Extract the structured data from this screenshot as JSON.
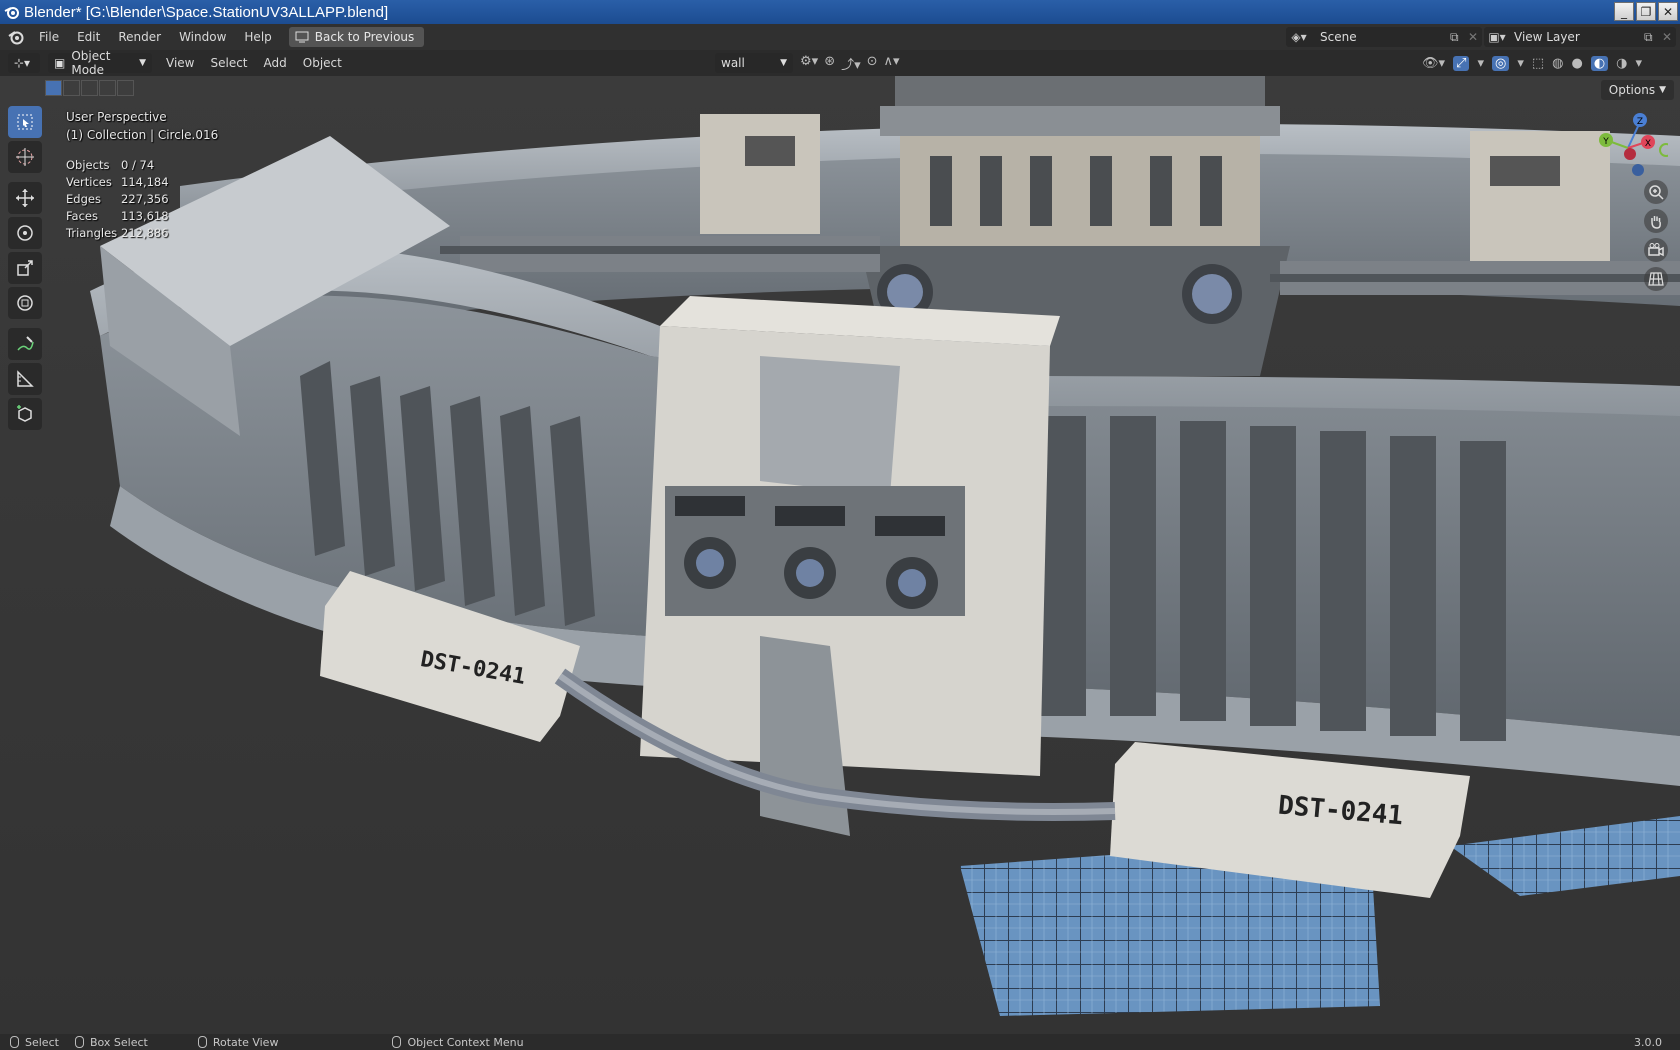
{
  "window": {
    "title": "Blender* [G:\\Blender\\Space.StationUV3ALLAPP.blend]",
    "controls": [
      "minimize-icon",
      "restore-icon",
      "close-icon"
    ]
  },
  "topbar": {
    "menus": [
      "File",
      "Edit",
      "Render",
      "Window",
      "Help"
    ],
    "back_to_previous": "Back to Previous",
    "scene_name": "Scene",
    "view_layer": "View Layer"
  },
  "viewport_header": {
    "mode": "Object Mode",
    "menus": [
      "View",
      "Select",
      "Add",
      "Object"
    ],
    "material_dropdown": "wall",
    "options_label": "Options"
  },
  "overlay": {
    "perspective": "User Perspective",
    "collection": "(1) Collection | Circle.016",
    "stats": [
      {
        "label": "Objects",
        "value": "0 / 74"
      },
      {
        "label": "Vertices",
        "value": "114,184"
      },
      {
        "label": "Edges",
        "value": "227,356"
      },
      {
        "label": "Faces",
        "value": "113,618"
      },
      {
        "label": "Triangles",
        "value": "212,886"
      }
    ],
    "labels": [
      "DST-0241",
      "DST-0241"
    ]
  },
  "tools": [
    "select-box-icon",
    "cursor-icon",
    "move-icon",
    "rotate-icon",
    "scale-icon",
    "transform-icon",
    "annotate-icon",
    "measure-icon",
    "add-cube-icon"
  ],
  "gizmo": {
    "x": "X",
    "y": "Y",
    "z": "Z"
  },
  "statusbar": {
    "select": "Select",
    "box_select": "Box Select",
    "rotate_view": "Rotate View",
    "context_menu": "Object Context Menu",
    "version": "3.0.0"
  },
  "colors": {
    "accent": "#4772b3",
    "titlebar": "#1c4c91",
    "viewport_bg": "#3a3a3a"
  }
}
